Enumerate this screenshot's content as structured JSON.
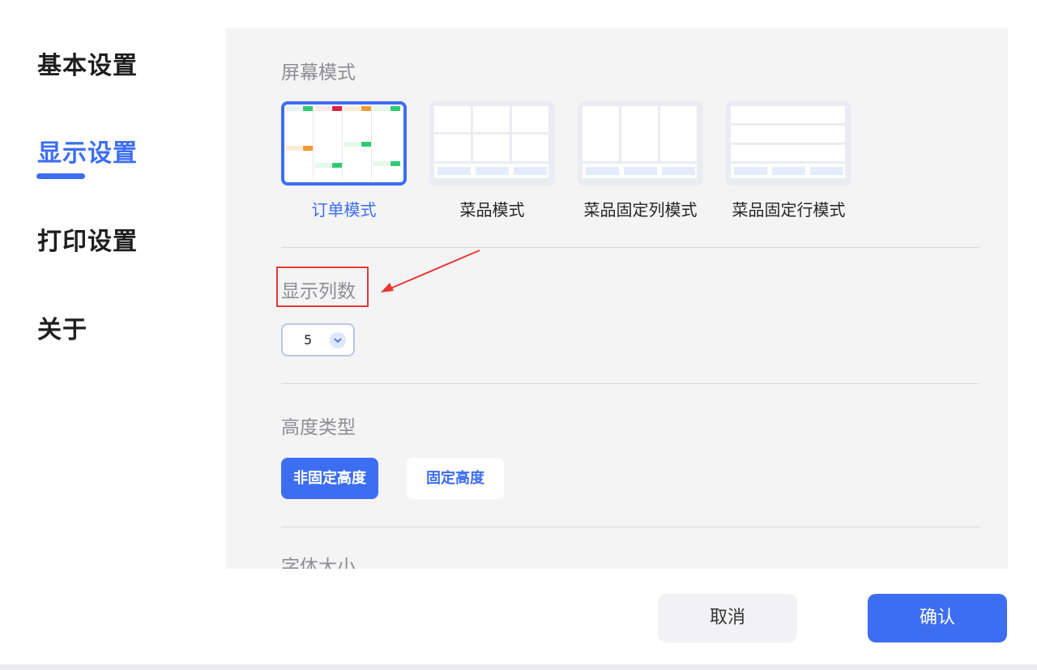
{
  "sidebar": {
    "items": [
      {
        "label": "基本设置",
        "active": false
      },
      {
        "label": "显示设置",
        "active": true
      },
      {
        "label": "打印设置",
        "active": false
      },
      {
        "label": "关于",
        "active": false
      }
    ]
  },
  "screen_mode": {
    "title": "屏幕模式",
    "options": [
      {
        "label": "订单模式",
        "selected": true
      },
      {
        "label": "菜品模式",
        "selected": false
      },
      {
        "label": "菜品固定列模式",
        "selected": false
      },
      {
        "label": "菜品固定行模式",
        "selected": false
      }
    ]
  },
  "columns": {
    "title": "显示列数",
    "value": "5"
  },
  "height_type": {
    "title": "高度类型",
    "options": [
      {
        "label": "非固定高度",
        "selected": true
      },
      {
        "label": "固定高度",
        "selected": false
      }
    ]
  },
  "font_size": {
    "title": "字体大小"
  },
  "footer": {
    "cancel_label": "取消",
    "confirm_label": "确认"
  },
  "colors": {
    "accent": "#3d6ef2",
    "annotation": "#e53935",
    "panel_bg": "#f4f4f5"
  }
}
